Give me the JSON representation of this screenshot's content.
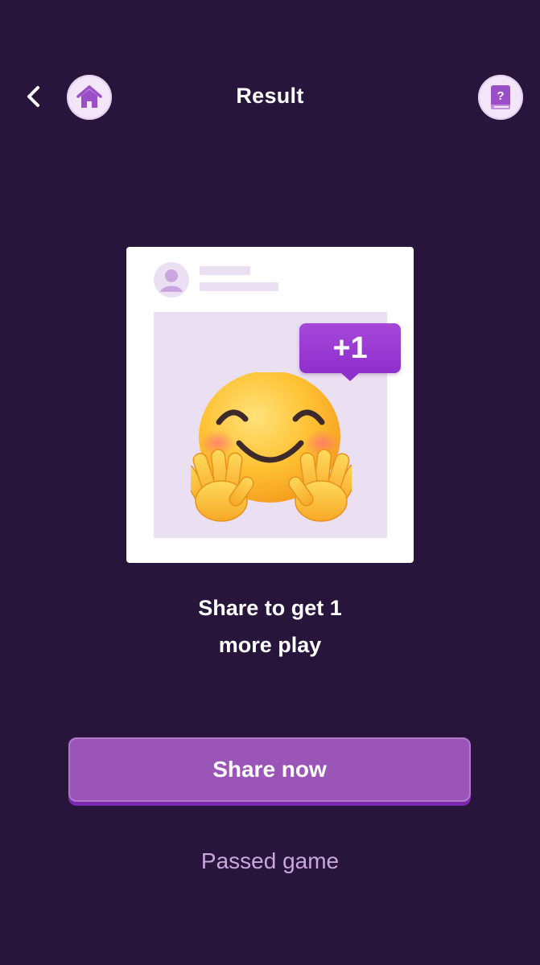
{
  "header": {
    "title": "Result",
    "back_icon": "chevron-left-icon",
    "home_icon": "home-icon",
    "help_icon": "help-book-icon"
  },
  "card": {
    "badge_text": "+1",
    "emoji": "smiling-face-with-open-hands-icon",
    "avatar_icon": "user-avatar-icon"
  },
  "message": {
    "line1": "Share to get 1",
    "line2": "more play"
  },
  "actions": {
    "share_label": "Share now",
    "passed_label": "Passed game"
  },
  "colors": {
    "background": "#28153b",
    "accent": "#9b55b8",
    "badge": "#a548d9",
    "link": "#c9a6de"
  }
}
